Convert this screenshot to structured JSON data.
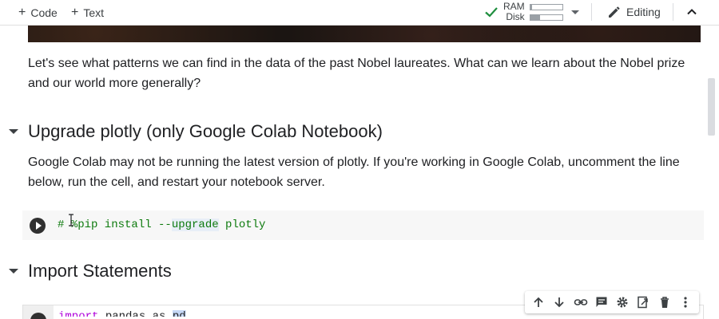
{
  "toolbar": {
    "add_code": "Code",
    "add_text": "Text",
    "ram_label": "RAM",
    "disk_label": "Disk",
    "ram_fraction": 0.05,
    "disk_fraction": 0.3,
    "editing_label": "Editing"
  },
  "intro": {
    "text": "Let's see what patterns we can find in the data of the past Nobel laureates. What can we learn about the Nobel prize and our world more generally?"
  },
  "section_upgrade": {
    "heading": "Upgrade plotly (only Google Colab Notebook)",
    "body": "Google Colab may not be running the latest version of plotly. If you're working in Google Colab, uncomment the line below, run the cell, and restart your notebook server.",
    "code_prefix": "# %pip install --",
    "code_highlight": "upgrade",
    "code_suffix": " plotly"
  },
  "section_imports": {
    "heading": "Import Statements",
    "code_kw": "import",
    "code_mid": " pandas as ",
    "code_sel": "pd"
  },
  "colors": {
    "check_green": "#1e8e3e",
    "code_comment": "#0d7a0d"
  },
  "icons": [
    "check-icon",
    "pencil-icon",
    "chevron-up-icon",
    "arrow-up-icon",
    "arrow-down-icon",
    "link-icon",
    "comment-icon",
    "gear-icon",
    "mirror-cell-icon",
    "trash-icon",
    "more-vert-icon"
  ]
}
